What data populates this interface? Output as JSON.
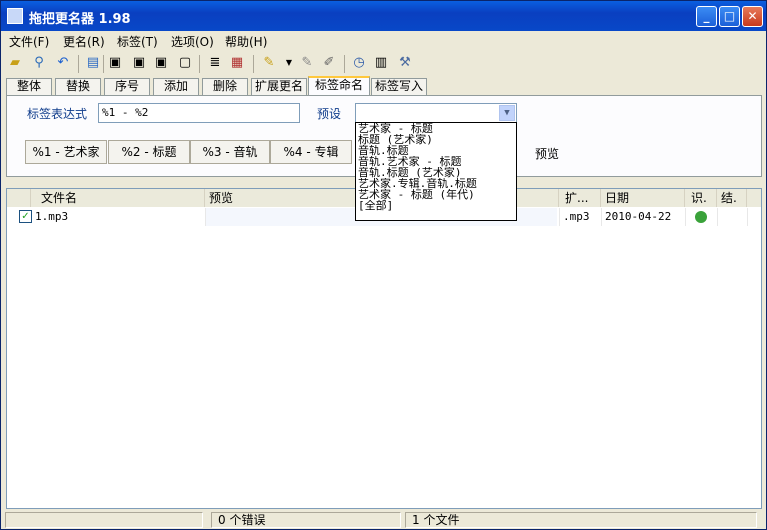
{
  "window": {
    "title": "拖把更名器 1.98"
  },
  "titlebar_buttons": {
    "minimize": "_",
    "maximize": "□",
    "close": "✕"
  },
  "menu": [
    "文件(F)",
    "更名(R)",
    "标签(T)",
    "选项(O)",
    "帮助(H)"
  ],
  "toolbar": {
    "icons": [
      "open-folder-icon",
      "search-icon",
      "undo-icon",
      "tag-icon",
      "tag-edit-icon",
      "tag-copy-icon",
      "tag-clear-icon",
      "list-icon",
      "doc-icon",
      "brush-icon",
      "format-icon",
      "delete-tag-icon",
      "history-icon",
      "preview-icon",
      "tools-icon"
    ]
  },
  "tabs": [
    "整体",
    "替换",
    "序号",
    "添加",
    "删除",
    "扩展更名",
    "标签命名",
    "标签写入"
  ],
  "active_tab": "标签命名",
  "form": {
    "expression_label": "标签表达式",
    "expression_value": "%1 - %2",
    "preset_label": "预设",
    "preset_value": ""
  },
  "variables": [
    "%1 - 艺术家",
    "%2 - 标题",
    "%3 - 音轨",
    "%4 - 专辑"
  ],
  "preview_label": "预览",
  "preset_options": [
    "艺术家 - 标题",
    "标题 (艺术家)",
    "音轨.标题",
    "音轨.艺术家 - 标题",
    "音轨.标题 (艺术家)",
    "艺术家.专辑.音轨.标题",
    "艺术家 - 标题 (年代)",
    "[全部]"
  ],
  "columns": [
    "文件名",
    "预览",
    "扩...",
    "日期",
    "识.",
    "结."
  ],
  "rows": [
    {
      "filename": "1.mp3",
      "preview": "",
      "ext": ".mp3",
      "date": "2010-04-22",
      "checked": "✓"
    }
  ],
  "statusbar": {
    "errors": "0 个错误",
    "files": "1 个文件"
  },
  "colors": {
    "titlebar": "#0a5fe0",
    "active_tab_accent": "#ffc83c",
    "status_ok": "#3aa23a"
  }
}
